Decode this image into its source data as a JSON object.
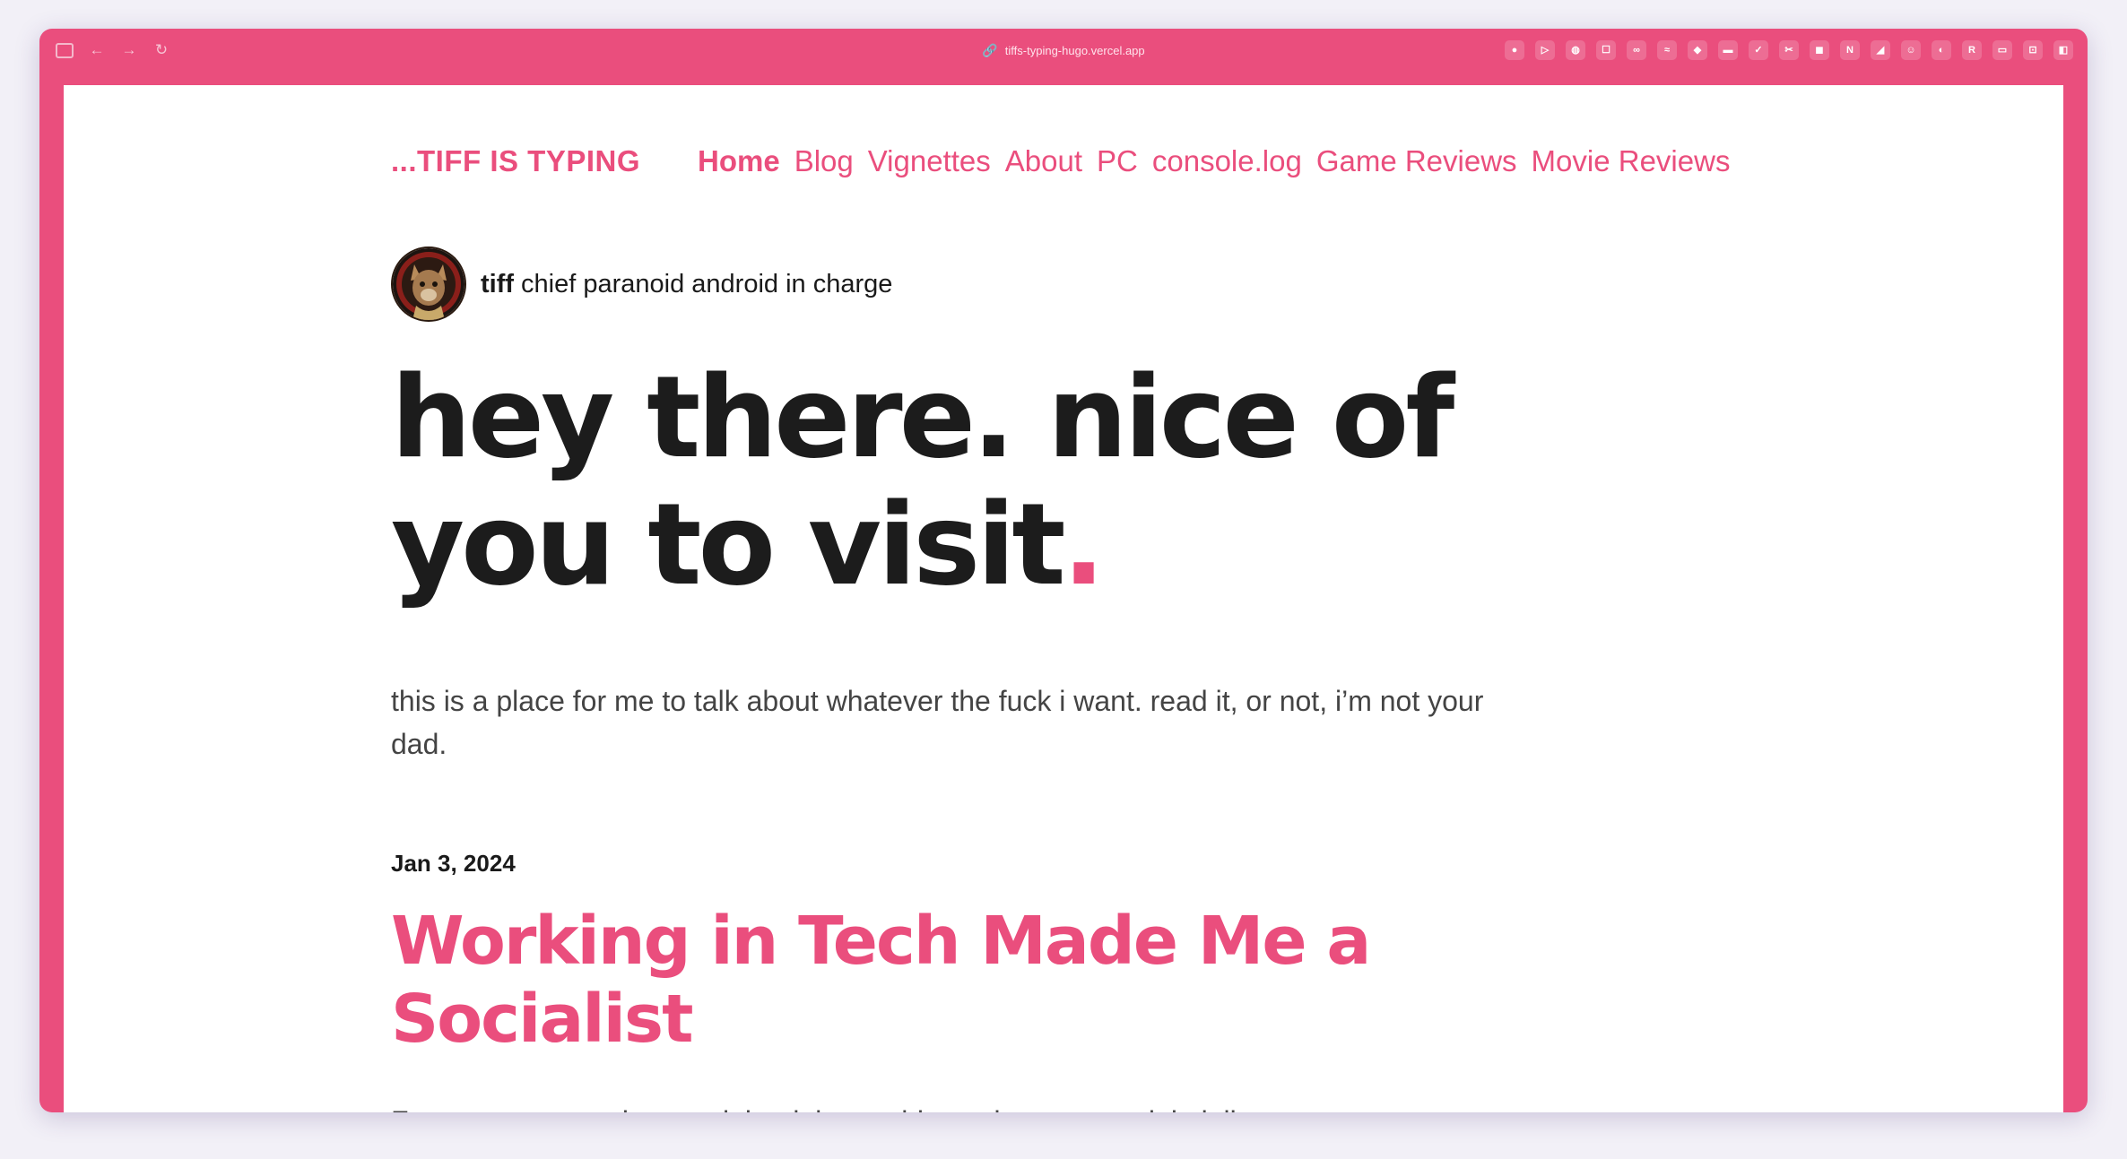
{
  "browser": {
    "url": "tiffs-typing-hugo.vercel.app",
    "link_glyph": "🔗",
    "nav_glyphs": {
      "back": "←",
      "forward": "→",
      "reload": "↻"
    },
    "extensions": [
      "●",
      "▷",
      "◍",
      "☐",
      "∞",
      "≈",
      "◆",
      "▬",
      "✓",
      "✂",
      "◼",
      "N",
      "◢",
      "☺",
      "◐",
      "R",
      "▭",
      "⊡",
      "◧"
    ]
  },
  "site": {
    "brand": "...TIFF IS TYPING",
    "nav": [
      "Home",
      "Blog",
      "Vignettes",
      "About",
      "PC",
      "console.log",
      "Game Reviews",
      "Movie Reviews"
    ],
    "active_nav": "Home",
    "accent_color": "#ea4e7d"
  },
  "author": {
    "name": "tiff",
    "tagline": "chief paranoid android in charge"
  },
  "hero": {
    "line1": "hey there. nice of",
    "line2": "you to visit",
    "period": "."
  },
  "intro": "this is a place for me to talk about whatever the fuck i want. read it, or not, i’m not your dad.",
  "post": {
    "date": "Jan 3, 2024",
    "title": "Working in Tech Made Me a Socialist",
    "excerpt": "For as many people complained the world not shown to explain it list"
  }
}
